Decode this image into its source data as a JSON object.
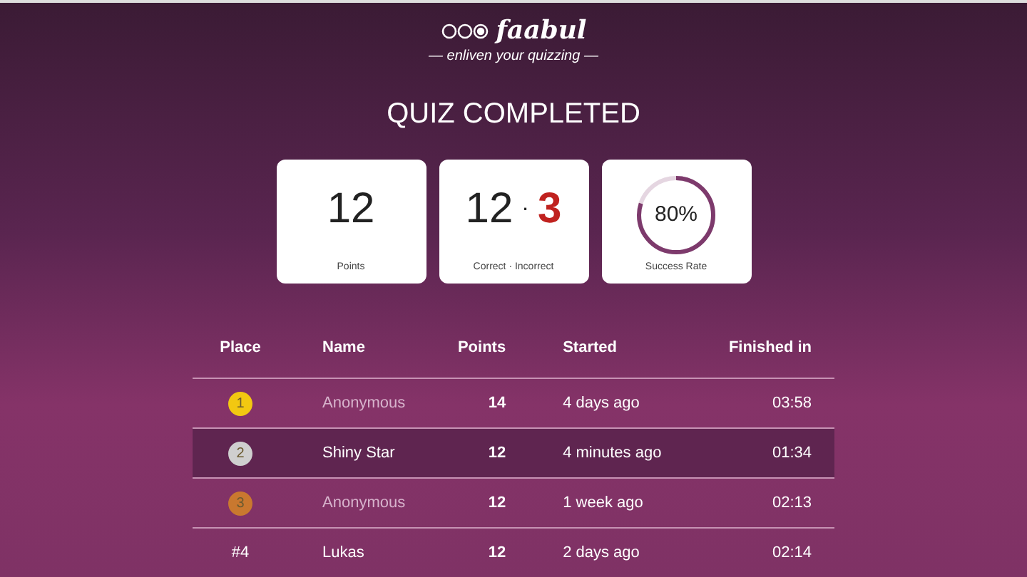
{
  "logo": {
    "name": "faabul",
    "tagline": "— enliven your quizzing —"
  },
  "title": "QUIZ COMPLETED",
  "stats": [
    {
      "kind": "number",
      "value": "12",
      "label": "Points"
    },
    {
      "kind": "split",
      "correct": "12",
      "separator": "·",
      "incorrect": "3",
      "label": "Correct · Incorrect"
    },
    {
      "kind": "ring",
      "value": "80%",
      "level": 0.8,
      "label": "Success Rate"
    }
  ],
  "table": {
    "columns": [
      "Place",
      "Name",
      "Points",
      "Started",
      "Finished in"
    ],
    "rows": [
      {
        "place": "1",
        "kind": "medal",
        "color": "#f2c811",
        "name": "Anonymous",
        "anonymous": true,
        "points": "14",
        "started": "4 days ago",
        "finished": "03:58",
        "selected": false
      },
      {
        "place": "2",
        "kind": "medal",
        "color": "#cfcfcf",
        "name": "Shiny Star",
        "anonymous": false,
        "points": "12",
        "started": "4 minutes ago",
        "finished": "01:34",
        "selected": true
      },
      {
        "place": "3",
        "kind": "medal",
        "color": "#c9782f",
        "name": "Anonymous",
        "anonymous": true,
        "points": "12",
        "started": "1 week ago",
        "finished": "02:13",
        "selected": false
      },
      {
        "place": "#4",
        "kind": "rank",
        "name": "Lukas",
        "anonymous": false,
        "points": "12",
        "started": "2 days ago",
        "finished": "02:14",
        "selected": false
      }
    ]
  }
}
